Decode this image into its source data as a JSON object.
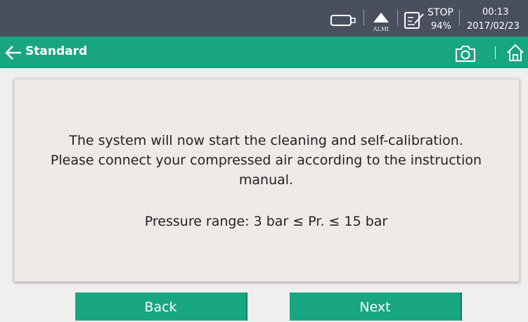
{
  "status": {
    "alarm_label": "ALMI",
    "run_state": "STOP",
    "battery_percent": "94%",
    "time": "00:13",
    "date": "2017/02/23"
  },
  "header": {
    "title": "Standard"
  },
  "dialog": {
    "message_line1": "The system will now start the cleaning and self-calibration.",
    "message_line2": "Please connect your compressed air according to the instruction",
    "message_line3": "manual.",
    "pressure_text": "Pressure range: 3 bar ≤ Pr. ≤ 15 bar"
  },
  "buttons": {
    "back_label": "Back",
    "next_label": "Next"
  },
  "colors": {
    "status_bar": "#4a4f5e",
    "accent": "#18a682",
    "background": "#f1efed"
  },
  "icons": [
    "usb-icon",
    "alarm-icon",
    "document-edit-icon",
    "back-arrow-icon",
    "camera-icon",
    "home-icon"
  ]
}
